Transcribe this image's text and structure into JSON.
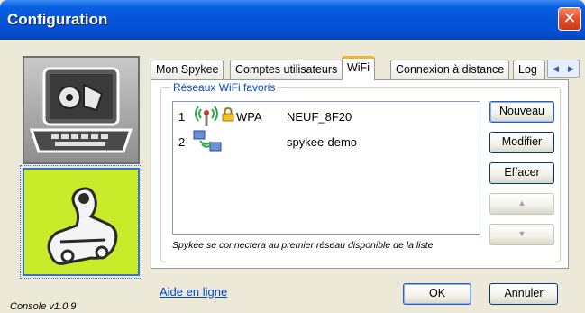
{
  "window": {
    "title": "Configuration",
    "close_glyph": "✕"
  },
  "tabs": [
    {
      "label": "Mon Spykee"
    },
    {
      "label": "Comptes utilisateurs"
    },
    {
      "label": "WiFi",
      "active": true
    },
    {
      "label": "Connexion à distance"
    },
    {
      "label": "Log"
    }
  ],
  "tab_scroll": {
    "left": "◀",
    "right": "▶"
  },
  "wifi": {
    "group_label": "Réseaux WiFi favoris",
    "networks": [
      {
        "index": "1",
        "icon": "wifi-antenna-icon",
        "secured": true,
        "security": "WPA",
        "name": "NEUF_8F20"
      },
      {
        "index": "2",
        "icon": "network-computers-icon",
        "secured": false,
        "security": "",
        "name": "spykee-demo"
      }
    ],
    "hint": "Spykee se connectera au premier réseau disponible de la liste",
    "buttons": {
      "new": "Nouveau",
      "modify": "Modifier",
      "delete": "Effacer",
      "up": "▲",
      "down": "▼"
    }
  },
  "footer": {
    "help_link": "Aide en ligne",
    "ok": "OK",
    "cancel": "Annuler",
    "version": "Console v1.0.9"
  },
  "colors": {
    "titlebar": "#0554d8",
    "accent_green": "#c9ec2a",
    "link": "#0046d5"
  }
}
